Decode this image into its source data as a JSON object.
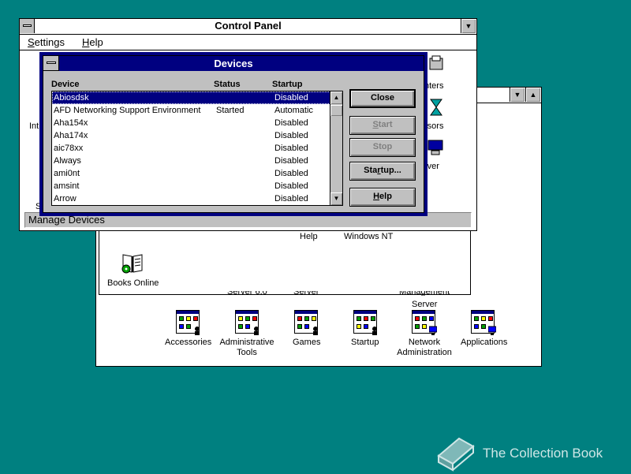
{
  "control_panel": {
    "title": "Control Panel",
    "menu": [
      {
        "mnemonic": "S",
        "rest": "ettings"
      },
      {
        "mnemonic": "H",
        "rest": "elp"
      }
    ],
    "scroll_down_glyph": "▼",
    "icon_labels": {
      "printers_fragment": "nters",
      "cursors_fragment": "rsors",
      "server_fragment": "rver",
      "international_fragment": "Int",
      "s_fragment": "S"
    },
    "status_text": "Manage Devices"
  },
  "program_manager": {
    "minimize_glyph": "▼",
    "maximize_glyph": "▲",
    "upper_labels": {
      "help": "Help",
      "windows_nt": "Windows NT",
      "books_online": "Books Online"
    },
    "clipped_labels": [
      "Server 6.0",
      "Server",
      "Management",
      "Server"
    ],
    "groups": [
      {
        "label": "Accessories"
      },
      {
        "label": "Administrative\nTools"
      },
      {
        "label": "Games"
      },
      {
        "label": "Startup"
      },
      {
        "label": "Network\nAdministration"
      },
      {
        "label": "Applications"
      }
    ]
  },
  "devices_dialog": {
    "title": "Devices",
    "columns": {
      "device": "Device",
      "status": "Status",
      "startup": "Startup"
    },
    "rows": [
      {
        "device": "Abiosdsk",
        "status": "",
        "startup": "Disabled",
        "selected": true
      },
      {
        "device": "AFD Networking Support Environment",
        "status": "Started",
        "startup": "Automatic"
      },
      {
        "device": "Aha154x",
        "status": "",
        "startup": "Disabled"
      },
      {
        "device": "Aha174x",
        "status": "",
        "startup": "Disabled"
      },
      {
        "device": "aic78xx",
        "status": "",
        "startup": "Disabled"
      },
      {
        "device": "Always",
        "status": "",
        "startup": "Disabled"
      },
      {
        "device": "ami0nt",
        "status": "",
        "startup": "Disabled"
      },
      {
        "device": "amsint",
        "status": "",
        "startup": "Disabled"
      },
      {
        "device": "Arrow",
        "status": "",
        "startup": "Disabled"
      }
    ],
    "scroll_up_glyph": "▲",
    "scroll_down_glyph": "▼",
    "buttons": {
      "close": {
        "label": "Close"
      },
      "start": {
        "mnemonic": "S",
        "rest": "tart",
        "enabled": false
      },
      "stop": {
        "mnemonic": "S",
        "rest": "top",
        "enabled": false
      },
      "startup": {
        "pre": "Sta",
        "mnemonic": "r",
        "rest": "tup..."
      },
      "help": {
        "mnemonic": "H",
        "rest": "elp"
      }
    }
  },
  "watermark": {
    "text": "The Collection Book"
  },
  "colors": {
    "desktop": "#008080",
    "title_active": "#000080",
    "face": "#c0c0c0"
  }
}
